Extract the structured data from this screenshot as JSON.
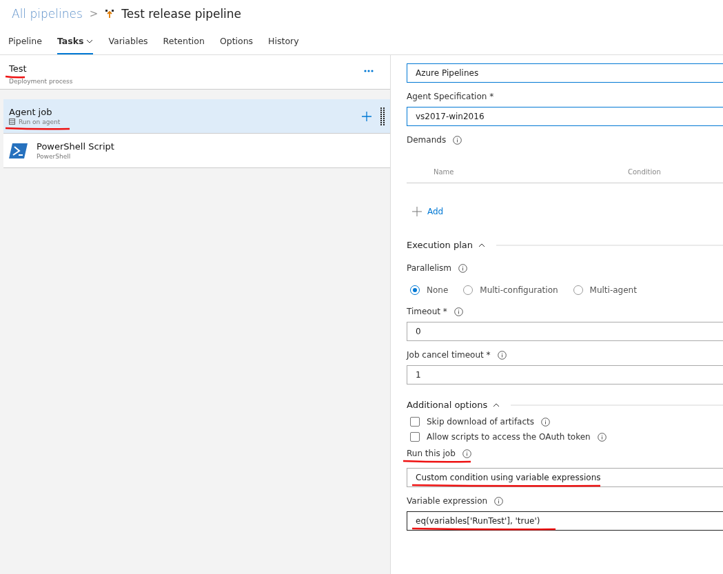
{
  "breadcrumb": {
    "parent": "All pipelines",
    "separator": ">",
    "title": "Test release pipeline"
  },
  "tabs": [
    {
      "label": "Pipeline",
      "selected": false,
      "dropdown": false
    },
    {
      "label": "Tasks",
      "selected": true,
      "dropdown": true
    },
    {
      "label": "Variables",
      "selected": false,
      "dropdown": false
    },
    {
      "label": "Retention",
      "selected": false,
      "dropdown": false
    },
    {
      "label": "Options",
      "selected": false,
      "dropdown": false
    },
    {
      "label": "History",
      "selected": false,
      "dropdown": false
    }
  ],
  "stage": {
    "name": "Test",
    "subtitle": "Deployment process",
    "underlined": true
  },
  "jobs": [
    {
      "kind": "job",
      "title": "Agent job",
      "subtitle": "Run on agent",
      "selected": true,
      "underlined": true
    },
    {
      "kind": "task",
      "title": "PowerShell Script",
      "subtitle": "PowerShell",
      "selected": false,
      "underlined": false
    }
  ],
  "agent_pool": {
    "value": "Azure Pipelines"
  },
  "agent_specification": {
    "label": "Agent Specification *",
    "value": "vs2017-win2016"
  },
  "demands": {
    "label": "Demands",
    "columns": [
      "Name",
      "Condition"
    ],
    "add_label": "Add"
  },
  "execution_plan": {
    "title": "Execution plan",
    "expanded": true,
    "parallelism_label": "Parallelism",
    "parallelism_options": [
      {
        "label": "None",
        "selected": true
      },
      {
        "label": "Multi-configuration",
        "selected": false
      },
      {
        "label": "Multi-agent",
        "selected": false
      }
    ],
    "timeout_label": "Timeout *",
    "timeout_value": "0",
    "cancel_label": "Job cancel timeout *",
    "cancel_value": "1"
  },
  "additional_options": {
    "title": "Additional options",
    "expanded": true,
    "checkboxes": [
      {
        "label": "Skip download of artifacts",
        "checked": false
      },
      {
        "label": "Allow scripts to access the OAuth token",
        "checked": false
      }
    ],
    "run_label": "Run this job",
    "run_label_underlined": true,
    "run_value": "Custom condition using variable expressions",
    "run_value_underlined": true,
    "expression_label": "Variable expression",
    "expression_value": "eq(variables['RunTest'], 'true')",
    "expression_underlined": true
  }
}
